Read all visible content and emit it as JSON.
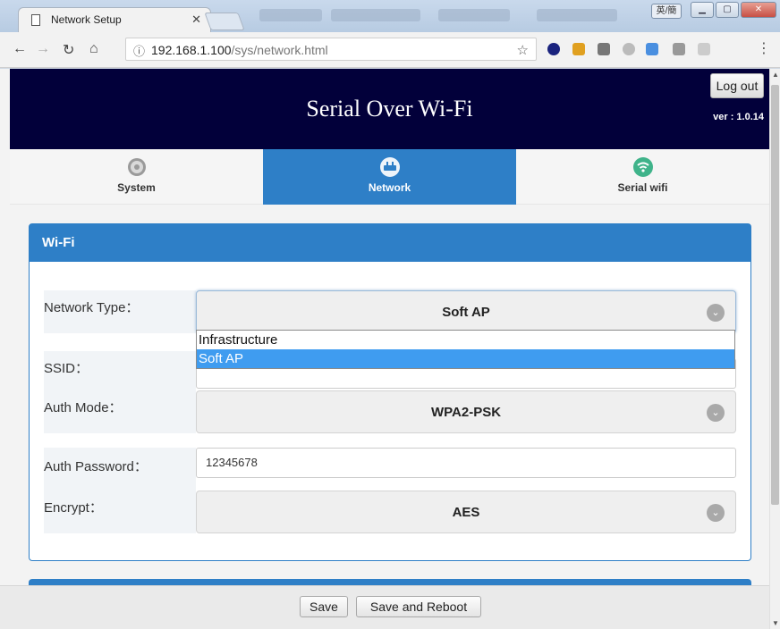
{
  "browser": {
    "tab_title": "Network Setup",
    "url_host": "192.168.1.100",
    "url_path": "/sys/network.html",
    "ime_label": "英/簡"
  },
  "header": {
    "title": "Serial Over Wi-Fi",
    "logout_label": "Log out",
    "version": "ver : 1.0.14"
  },
  "tabs": [
    {
      "label": "System",
      "icon": "gear-icon"
    },
    {
      "label": "Network",
      "icon": "router-icon",
      "active": true
    },
    {
      "label": "Serial wifi",
      "icon": "wifi-icon"
    }
  ],
  "wifi_panel": {
    "title": "Wi-Fi",
    "network_type": {
      "label": "Network Type：",
      "value": "Soft AP",
      "options": [
        "Infrastructure",
        "Soft AP"
      ]
    },
    "ssid": {
      "label": "SSID："
    },
    "auth_mode": {
      "label": "Auth Mode：",
      "value": "WPA2-PSK"
    },
    "auth_password": {
      "label": "Auth Password：",
      "value": "12345678"
    },
    "encrypt": {
      "label": "Encrypt：",
      "value": "AES"
    }
  },
  "footer": {
    "save_label": "Save",
    "save_reboot_label": "Save and Reboot"
  },
  "colors": {
    "header_bg": "#02003a",
    "accent": "#2e7fc7",
    "dropdown_selected": "#3f9cf0"
  }
}
